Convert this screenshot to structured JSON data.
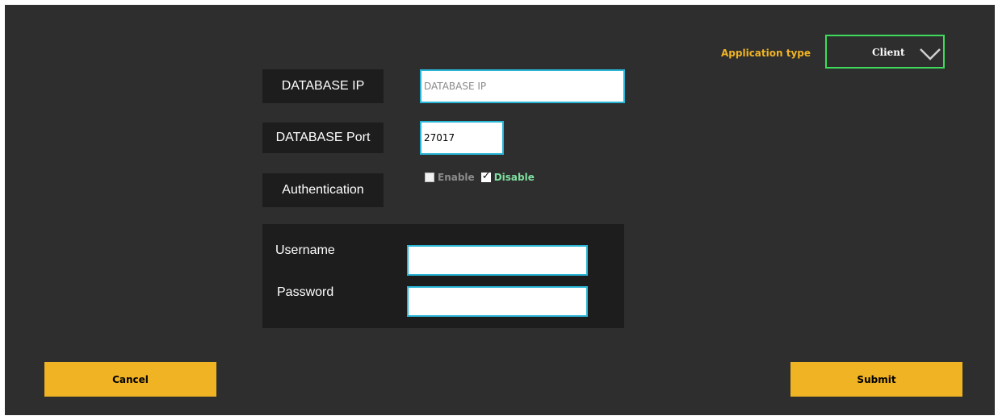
{
  "form": {
    "db_ip_label": "DATABASE IP",
    "db_ip_placeholder": "DATABASE IP",
    "db_ip_value": "",
    "db_port_label": "DATABASE Port",
    "db_port_value": "27017",
    "auth_label": "Authentication",
    "auth_enable_label": "Enable",
    "auth_enable_checked": false,
    "auth_disable_label": "Disable",
    "auth_disable_checked": true,
    "username_label": "Username",
    "username_value": "",
    "password_label": "Password",
    "password_value": ""
  },
  "app_type": {
    "label": "Application type",
    "selected": "Client"
  },
  "buttons": {
    "cancel": "Cancel",
    "submit": "Submit"
  },
  "colors": {
    "accent": "#f0b323",
    "dropdown_border": "#3ddc5a",
    "input_border": "#29b6d6",
    "background": "#2e2e2e",
    "panel": "#1d1d1d"
  }
}
